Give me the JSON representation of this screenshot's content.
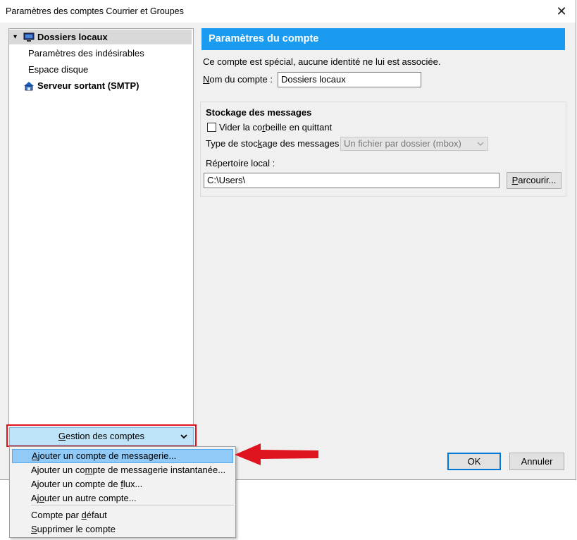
{
  "window": {
    "title": "Paramètres des comptes Courrier et Groupes",
    "close_glyph": "✕"
  },
  "tree": {
    "items": [
      {
        "label": "Dossiers locaux",
        "expander": "▾",
        "icon": "computer-icon"
      },
      {
        "label": "Paramètres des indésirables"
      },
      {
        "label": "Espace disque"
      },
      {
        "label": "Serveur sortant (SMTP)",
        "icon": "server-icon"
      }
    ]
  },
  "panel": {
    "header": "Paramètres du compte",
    "info": "Ce compte est spécial, aucune identité ne lui est associée.",
    "account_name_label": "Nom du compte :",
    "account_name_value": "Dossiers locaux",
    "storage": {
      "title": "Stockage des messages",
      "empty_trash_label": "Vider la corbeille en quittant",
      "empty_trash_checked": false,
      "storage_type_label": "Type de stockage des messages :",
      "storage_type_value": "Un fichier par dossier (mbox)",
      "local_dir_label": "Répertoire local :",
      "local_dir_value": "C:\\Users\\",
      "browse_label": "Parcourir..."
    }
  },
  "footer": {
    "ok_label": "OK",
    "cancel_label": "Annuler"
  },
  "account_actions": {
    "label": "Gestion des comptes",
    "chevron": "⌄",
    "menu": [
      "Ajouter un compte de messagerie...",
      "Ajouter un compte de messagerie instantanée...",
      "Ajouter un compte de flux...",
      "Ajouter un autre compte...",
      "Compte par défaut",
      "Supprimer le compte"
    ]
  },
  "colors": {
    "accent": "#1a9bef",
    "highlight": "#91c9f7",
    "annotation": "#e0141e"
  }
}
